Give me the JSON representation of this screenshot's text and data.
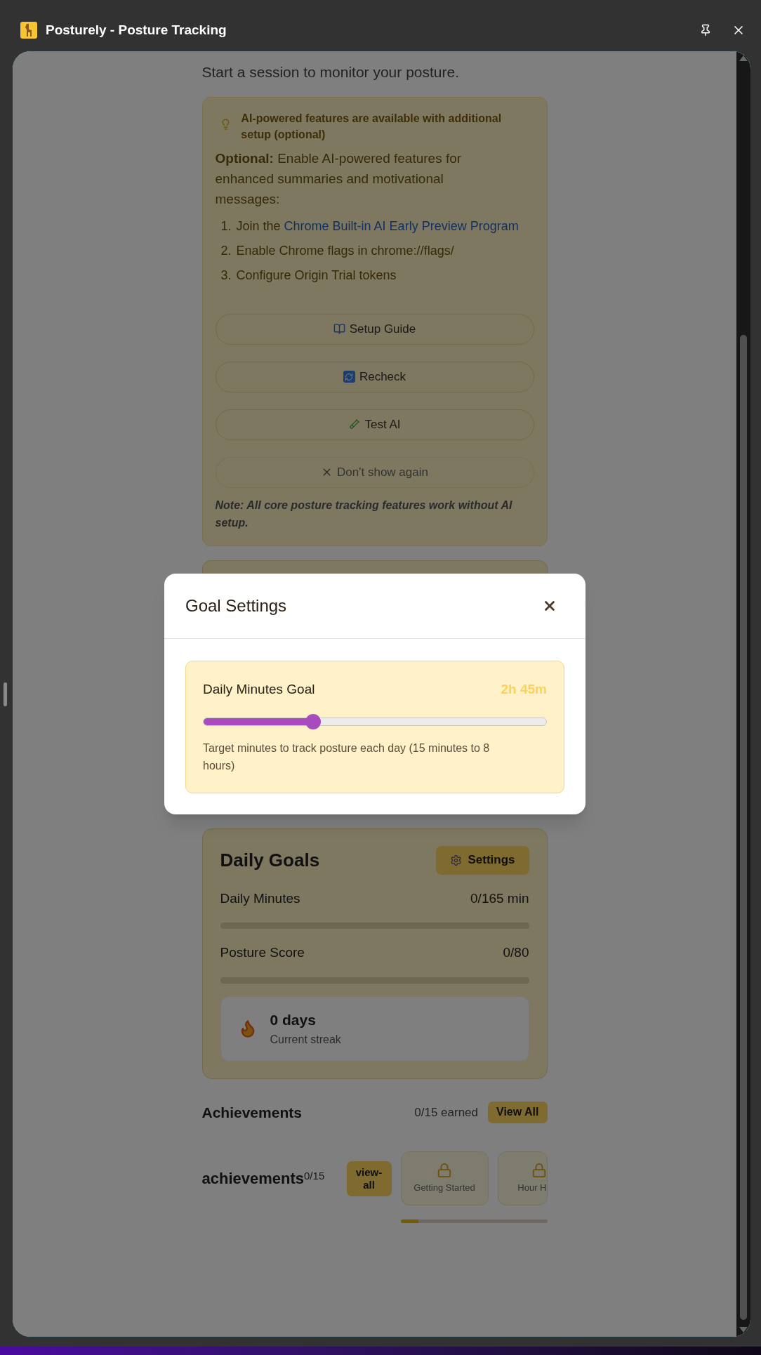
{
  "window": {
    "title": "Posturely - Posture Tracking"
  },
  "subtitle": "Start a session to monitor your posture.",
  "ai_notice": {
    "header": "AI-powered features are available with additional setup (optional)",
    "intro": "**Optional:** Enable AI-powered features for enhanced summaries and motivational messages:",
    "steps": [
      {
        "number": "1.",
        "text": "Join the",
        "link": "Chrome Built-in AI Early Preview Program"
      },
      {
        "number": "2.",
        "text": "Enable Chrome flags in chrome://flags/"
      },
      {
        "number": "3.",
        "text": "Configure Origin Trial tokens"
      }
    ],
    "buttons": [
      {
        "label": "Setup Guide",
        "kind": "guide"
      },
      {
        "label": "Recheck",
        "kind": "recheck"
      },
      {
        "label": "Test AI",
        "kind": "test"
      },
      {
        "label": "Don't show again",
        "kind": "dismiss"
      }
    ],
    "note": "Note: All core posture tracking features work without AI setup."
  },
  "daily_goals": {
    "title": "Daily Goals",
    "settings_button": "Settings",
    "goals": [
      {
        "label": "Daily Minutes",
        "value": "0/165 min",
        "level": 0
      },
      {
        "label": "Posture Score",
        "value": "0/80",
        "level": 0
      }
    ],
    "streak": {
      "value": "0 days",
      "label": "Current streak"
    }
  },
  "achievements": {
    "title": "Achievements",
    "earned": "0/15 earned",
    "view_all": "View All"
  },
  "achievements_widget": {
    "title": "achievements",
    "count": "0/15",
    "button": "view-all",
    "badges": [
      {
        "label": "Getting Started",
        "locked": true
      },
      {
        "label": "Hour H",
        "locked": true
      }
    ],
    "progress": {
      "level": 0.12
    }
  },
  "modal": {
    "title": "Goal Settings",
    "setting": {
      "label": "Daily Minutes Goal",
      "value": "2h 45m",
      "level": 0.32,
      "description": "Target minutes to track posture each day (15 minutes to 8 hours)"
    }
  }
}
